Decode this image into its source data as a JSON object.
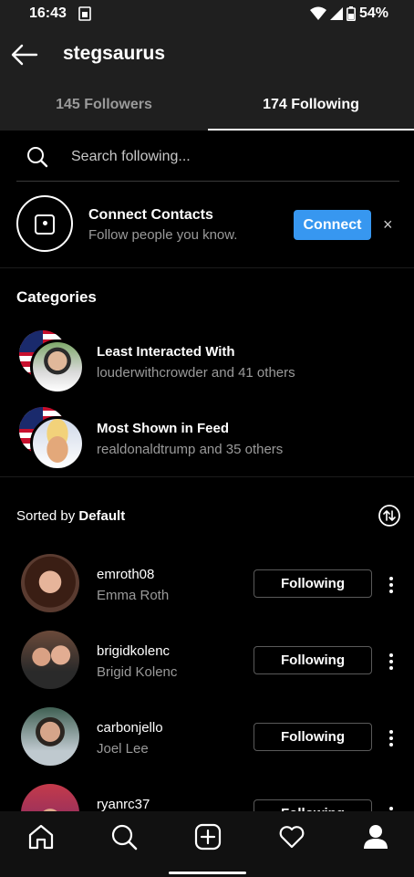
{
  "status_bar": {
    "time": "16:43",
    "battery": "54%"
  },
  "header": {
    "title": "stegsaurus"
  },
  "tabs": [
    {
      "label": "145 Followers"
    },
    {
      "label": "174 Following"
    }
  ],
  "search": {
    "placeholder": "Search following..."
  },
  "connect_contacts": {
    "title": "Connect Contacts",
    "subtitle": "Follow people you know.",
    "button": "Connect",
    "close": "×"
  },
  "categories": {
    "heading": "Categories",
    "items": [
      {
        "title": "Least Interacted With",
        "subtitle": "louderwithcrowder and 41 others"
      },
      {
        "title": "Most Shown in Feed",
        "subtitle": "realdonaldtrump and 35 others"
      }
    ]
  },
  "sort": {
    "prefix": "Sorted by ",
    "value": "Default"
  },
  "following": [
    {
      "username": "emroth08",
      "name": "Emma Roth",
      "button": "Following"
    },
    {
      "username": "brigidkolenc",
      "name": "Brigid Kolenc",
      "button": "Following"
    },
    {
      "username": "carbonjello",
      "name": "Joel Lee",
      "button": "Following"
    },
    {
      "username": "ryanrc37",
      "name": "",
      "button": "Following"
    }
  ],
  "colors": {
    "accent": "#3797f0",
    "background": "#000000",
    "header": "#1f1f1f"
  },
  "icons": [
    "back-arrow-icon",
    "search-icon",
    "contact-card-icon",
    "sort-icon",
    "more-icon",
    "home-icon",
    "explore-icon",
    "new-post-icon",
    "heart-icon",
    "profile-icon"
  ]
}
